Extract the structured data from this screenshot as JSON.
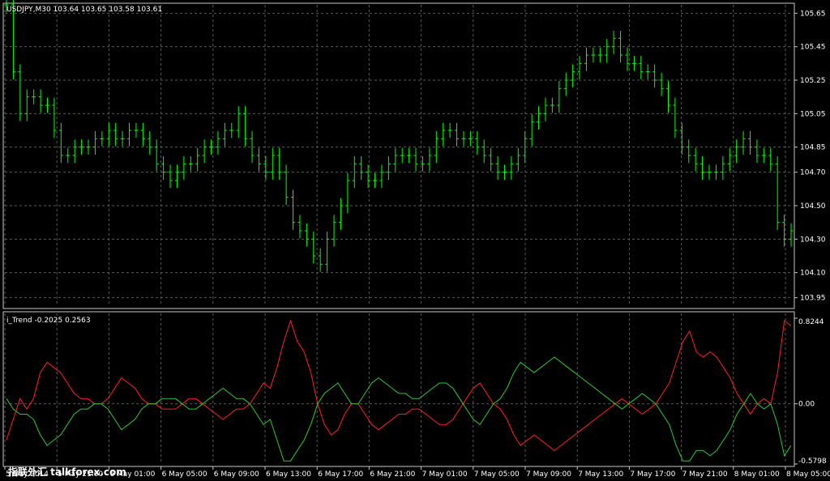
{
  "window": {
    "header": "USDJPY,M30  103.64 103.65 103.58 103.61",
    "indicator_header": "i_Trend -0.2025 0.2563",
    "watermark": "指联外汇 talkforex.com"
  },
  "colors": {
    "background": "#000000",
    "grid": "#5a5a5a",
    "frame": "#c8c8c8",
    "bars": "#00ff00",
    "indicator_red": "#ff2020",
    "indicator_green": "#30c830",
    "text": "#ffffff"
  },
  "chart_data": [
    {
      "type": "line",
      "name": "price",
      "title": "USDJPY,M30",
      "style": "ohlc-bars",
      "ylim": [
        103.9,
        105.7
      ],
      "y_ticks": [
        "105.65",
        "105.45",
        "105.25",
        "105.05",
        "104.85",
        "104.70",
        "104.50",
        "104.30",
        "104.10",
        "103.95"
      ],
      "grid": true,
      "series": [
        {
          "values": [
            105.7,
            105.3,
            105.05,
            105.15,
            105.15,
            105.1,
            105.1,
            104.95,
            104.8,
            104.8,
            104.85,
            104.85,
            104.85,
            104.9,
            104.9,
            104.95,
            104.9,
            104.9,
            104.95,
            104.95,
            104.9,
            104.85,
            104.75,
            104.7,
            104.65,
            104.7,
            104.75,
            104.75,
            104.8,
            104.85,
            104.85,
            104.9,
            104.95,
            104.95,
            105.05,
            104.9,
            104.8,
            104.75,
            104.7,
            104.8,
            104.7,
            104.55,
            104.4,
            104.35,
            104.3,
            104.2,
            104.15,
            104.3,
            104.4,
            104.5,
            104.65,
            104.75,
            104.7,
            104.65,
            104.65,
            104.7,
            104.75,
            104.8,
            104.8,
            104.8,
            104.75,
            104.75,
            104.8,
            104.9,
            104.95,
            104.95,
            104.9,
            104.9,
            104.9,
            104.85,
            104.8,
            104.75,
            104.7,
            104.7,
            104.75,
            104.8,
            104.9,
            105.0,
            105.05,
            105.1,
            105.1,
            105.2,
            105.25,
            105.3,
            105.35,
            105.4,
            105.4,
            105.4,
            105.45,
            105.5,
            105.4,
            105.35,
            105.35,
            105.3,
            105.3,
            105.25,
            105.2,
            105.1,
            104.95,
            104.85,
            104.8,
            104.75,
            104.7,
            104.7,
            104.7,
            104.75,
            104.8,
            104.85,
            104.9,
            104.85,
            104.8,
            104.8,
            104.75,
            104.4,
            104.3,
            104.35
          ]
        }
      ]
    },
    {
      "type": "line",
      "name": "i_Trend",
      "title": "i_Trend",
      "ylim": [
        -0.5798,
        0.8244
      ],
      "y_ticks": [
        "0.8244",
        "0.00",
        "-0.5798"
      ],
      "grid": true,
      "series": [
        {
          "color": "red",
          "values": [
            -0.35,
            -0.15,
            0.05,
            -0.05,
            0.05,
            0.3,
            0.4,
            0.35,
            0.3,
            0.2,
            0.1,
            0.05,
            0.05,
            0.0,
            0.0,
            0.05,
            0.15,
            0.25,
            0.2,
            0.15,
            0.05,
            0.0,
            0.0,
            -0.05,
            -0.05,
            -0.05,
            0.0,
            0.05,
            0.05,
            0.0,
            -0.05,
            -0.1,
            -0.15,
            -0.1,
            -0.05,
            -0.05,
            0.0,
            0.1,
            0.2,
            0.15,
            0.35,
            0.6,
            0.8,
            0.6,
            0.5,
            0.3,
            0.0,
            -0.2,
            -0.3,
            -0.25,
            -0.1,
            0.0,
            0.0,
            -0.1,
            -0.2,
            -0.25,
            -0.2,
            -0.15,
            -0.1,
            -0.1,
            -0.05,
            -0.05,
            -0.1,
            -0.15,
            -0.2,
            -0.2,
            -0.15,
            -0.05,
            0.05,
            0.15,
            0.2,
            0.1,
            0.0,
            -0.05,
            -0.15,
            -0.3,
            -0.4,
            -0.35,
            -0.3,
            -0.35,
            -0.4,
            -0.45,
            -0.4,
            -0.35,
            -0.3,
            -0.25,
            -0.2,
            -0.15,
            -0.1,
            -0.05,
            0.0,
            0.05,
            0.0,
            -0.05,
            -0.1,
            -0.05,
            0.0,
            0.1,
            0.2,
            0.4,
            0.6,
            0.7,
            0.5,
            0.45,
            0.5,
            0.45,
            0.35,
            0.25,
            0.1,
            0.0,
            -0.1,
            0.0,
            0.05,
            0.0,
            0.3,
            0.8,
            0.75
          ]
        },
        {
          "color": "green",
          "values": [
            0.05,
            -0.05,
            -0.1,
            -0.1,
            -0.15,
            -0.3,
            -0.4,
            -0.35,
            -0.3,
            -0.2,
            -0.1,
            -0.05,
            -0.05,
            0.0,
            0.0,
            -0.05,
            -0.15,
            -0.25,
            -0.2,
            -0.15,
            -0.05,
            0.0,
            0.0,
            0.05,
            0.05,
            0.05,
            0.0,
            -0.05,
            -0.05,
            0.0,
            0.05,
            0.1,
            0.15,
            0.1,
            0.05,
            0.05,
            0.0,
            -0.1,
            -0.2,
            -0.15,
            -0.35,
            -0.55,
            -0.55,
            -0.45,
            -0.35,
            -0.2,
            0.0,
            0.1,
            0.15,
            0.2,
            0.1,
            0.0,
            0.0,
            0.1,
            0.2,
            0.25,
            0.2,
            0.15,
            0.1,
            0.1,
            0.05,
            0.05,
            0.1,
            0.15,
            0.2,
            0.2,
            0.15,
            0.05,
            -0.05,
            -0.15,
            -0.2,
            -0.1,
            0.0,
            0.05,
            0.15,
            0.3,
            0.4,
            0.35,
            0.3,
            0.35,
            0.4,
            0.45,
            0.4,
            0.35,
            0.3,
            0.25,
            0.2,
            0.15,
            0.1,
            0.05,
            0.0,
            -0.05,
            0.0,
            0.05,
            0.1,
            0.05,
            0.0,
            -0.1,
            -0.2,
            -0.4,
            -0.55,
            -0.55,
            -0.45,
            -0.45,
            -0.5,
            -0.45,
            -0.35,
            -0.25,
            -0.1,
            0.0,
            0.1,
            0.0,
            -0.05,
            0.0,
            -0.2,
            -0.5,
            -0.4
          ]
        }
      ],
      "x_ticks": [
        "5 May 2014",
        "5 May 21:00",
        "6 May 01:00",
        "6 May 05:00",
        "6 May 09:00",
        "6 May 13:00",
        "6 May 17:00",
        "6 May 21:00",
        "7 May 01:00",
        "7 May 05:00",
        "7 May 09:00",
        "7 May 13:00",
        "7 May 17:00",
        "7 May 21:00",
        "8 May 01:00",
        "8 May 05:00"
      ]
    }
  ]
}
